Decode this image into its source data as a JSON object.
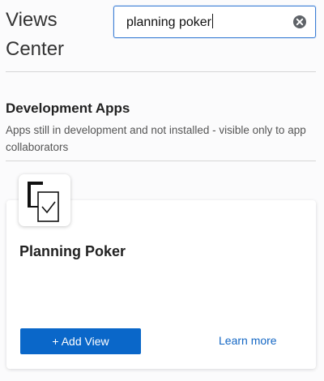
{
  "header": {
    "title_line1": "Views",
    "title_line2": "Center"
  },
  "search": {
    "value": "planning poker",
    "clear_icon": "clear-circle-x-icon"
  },
  "section": {
    "title": "Development Apps",
    "description": "Apps still in development and not installed - visible only to app collaborators"
  },
  "app_card": {
    "icon": "documents-checkmark-icon",
    "name": "Planning Poker",
    "add_view_label": "+ Add View",
    "learn_more_label": "Learn more"
  },
  "colors": {
    "primary_button": "#0a67c9",
    "link": "#1467c4",
    "search_focus_border": "#3e80d6"
  }
}
